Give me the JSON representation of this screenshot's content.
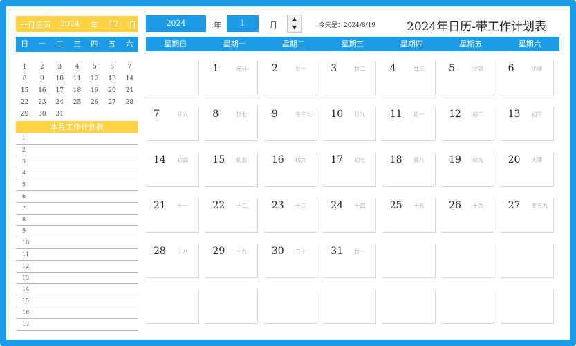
{
  "mini_calendar": {
    "header": {
      "month_label": "十月日历",
      "year": "2024",
      "year_unit": "年",
      "month": "12",
      "month_unit": "月"
    },
    "weekdays": [
      "日",
      "一",
      "二",
      "三",
      "四",
      "五",
      "六"
    ],
    "days": [
      "1",
      "2",
      "3",
      "4",
      "5",
      "6",
      "7",
      "8",
      "9",
      "10",
      "11",
      "12",
      "13",
      "14",
      "15",
      "16",
      "17",
      "18",
      "19",
      "20",
      "21",
      "22",
      "23",
      "24",
      "25",
      "26",
      "27",
      "28",
      "29",
      "30",
      "31"
    ]
  },
  "work_plan": {
    "title": "本月工作计划表",
    "rows": [
      "1",
      "2",
      "3",
      "4",
      "5",
      "6",
      "7",
      "8",
      "9",
      "10",
      "11",
      "12",
      "13",
      "14",
      "15",
      "16",
      "17"
    ]
  },
  "controls": {
    "year": "2024",
    "year_label": "年",
    "month": "1",
    "month_label": "月",
    "spin_up": "▲",
    "spin_down": "▼",
    "today": "今天是：2024/8/19"
  },
  "title": "2024年日历-带工作计划表",
  "calendar": {
    "weekdays": [
      "星期日",
      "星期一",
      "星期二",
      "星期三",
      "星期四",
      "星期五",
      "星期六"
    ],
    "cells": [
      {
        "day": "",
        "lunar": ""
      },
      {
        "day": "1",
        "lunar": "元旦"
      },
      {
        "day": "2",
        "lunar": "廿一"
      },
      {
        "day": "3",
        "lunar": "廿二"
      },
      {
        "day": "4",
        "lunar": "廿三"
      },
      {
        "day": "5",
        "lunar": "廿四"
      },
      {
        "day": "6",
        "lunar": "小寒"
      },
      {
        "day": "7",
        "lunar": "廿六"
      },
      {
        "day": "8",
        "lunar": "廿七"
      },
      {
        "day": "9",
        "lunar": "冬三九"
      },
      {
        "day": "10",
        "lunar": "廿九"
      },
      {
        "day": "11",
        "lunar": "初一"
      },
      {
        "day": "12",
        "lunar": "初二"
      },
      {
        "day": "13",
        "lunar": "初三"
      },
      {
        "day": "14",
        "lunar": "初四"
      },
      {
        "day": "15",
        "lunar": "初五"
      },
      {
        "day": "16",
        "lunar": "初六"
      },
      {
        "day": "17",
        "lunar": "初七"
      },
      {
        "day": "18",
        "lunar": "腊八"
      },
      {
        "day": "19",
        "lunar": "初九"
      },
      {
        "day": "20",
        "lunar": "大寒"
      },
      {
        "day": "21",
        "lunar": "十一"
      },
      {
        "day": "22",
        "lunar": "十二"
      },
      {
        "day": "23",
        "lunar": "十三"
      },
      {
        "day": "24",
        "lunar": "十四"
      },
      {
        "day": "25",
        "lunar": "十五"
      },
      {
        "day": "26",
        "lunar": "十六"
      },
      {
        "day": "27",
        "lunar": "冬五九"
      },
      {
        "day": "28",
        "lunar": "十八"
      },
      {
        "day": "29",
        "lunar": "十九"
      },
      {
        "day": "30",
        "lunar": "二十"
      },
      {
        "day": "31",
        "lunar": "廿一"
      },
      {
        "day": "",
        "lunar": ""
      },
      {
        "day": "",
        "lunar": ""
      },
      {
        "day": "",
        "lunar": ""
      },
      {
        "day": "",
        "lunar": ""
      },
      {
        "day": "",
        "lunar": ""
      },
      {
        "day": "",
        "lunar": ""
      },
      {
        "day": "",
        "lunar": ""
      },
      {
        "day": "",
        "lunar": ""
      },
      {
        "day": "",
        "lunar": ""
      },
      {
        "day": "",
        "lunar": ""
      }
    ]
  },
  "colors": {
    "accent": "#1e9be6",
    "highlight": "#fdd244"
  }
}
